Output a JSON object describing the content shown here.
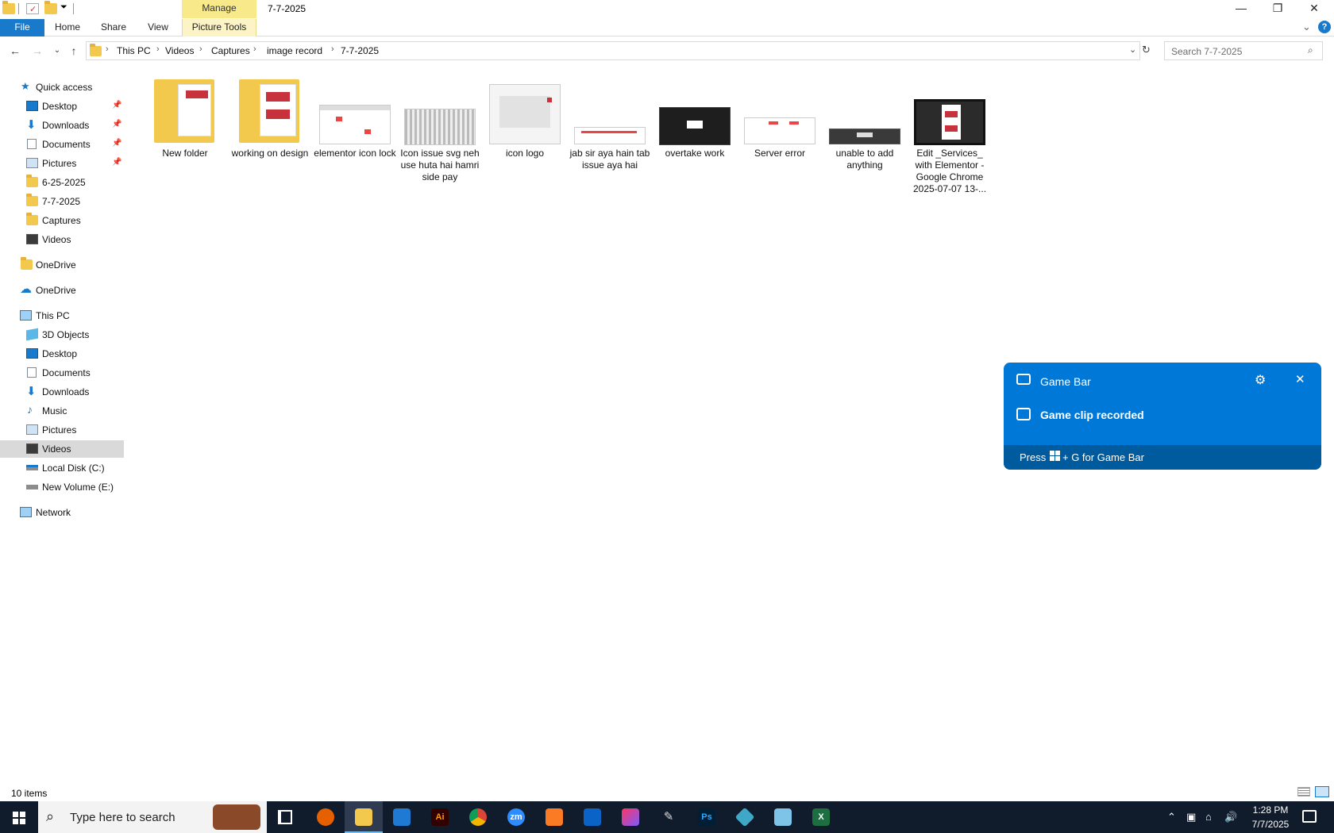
{
  "window": {
    "title": "7-7-2025",
    "manage_label": "Manage",
    "minimize": "—",
    "restore": "❐",
    "close": "✕"
  },
  "ribbon": {
    "tabs": [
      "File",
      "Home",
      "Share",
      "View",
      "Picture Tools"
    ],
    "collapse": "⌄",
    "help": "?"
  },
  "address": {
    "crumbs": [
      "This PC",
      "Videos",
      "Captures",
      "image record",
      "7-7-2025"
    ],
    "search_placeholder": "Search 7-7-2025"
  },
  "sidebar": {
    "quick_access": "Quick access",
    "quick_items": [
      {
        "label": "Desktop",
        "icon": "desktop-icon",
        "pinned": true
      },
      {
        "label": "Downloads",
        "icon": "download-icon",
        "pinned": true
      },
      {
        "label": "Documents",
        "icon": "documents-icon",
        "pinned": true
      },
      {
        "label": "Pictures",
        "icon": "pictures-icon",
        "pinned": true
      },
      {
        "label": "6-25-2025",
        "icon": "folder-icon",
        "pinned": false
      },
      {
        "label": "7-7-2025",
        "icon": "folder-icon",
        "pinned": false
      },
      {
        "label": "Captures",
        "icon": "folder-icon",
        "pinned": false
      },
      {
        "label": "Videos",
        "icon": "videos-icon",
        "pinned": false
      }
    ],
    "onedrive_1": "OneDrive",
    "onedrive_2": "OneDrive",
    "this_pc": "This PC",
    "pc_items": [
      {
        "label": "3D Objects",
        "icon": "3d-objects-icon"
      },
      {
        "label": "Desktop",
        "icon": "desktop-icon"
      },
      {
        "label": "Documents",
        "icon": "documents-icon"
      },
      {
        "label": "Downloads",
        "icon": "download-icon"
      },
      {
        "label": "Music",
        "icon": "music-icon"
      },
      {
        "label": "Pictures",
        "icon": "pictures-icon"
      },
      {
        "label": "Videos",
        "icon": "videos-icon"
      },
      {
        "label": "Local Disk (C:)",
        "icon": "local-disk-icon"
      },
      {
        "label": "New Volume (E:)",
        "icon": "drive-icon"
      }
    ],
    "network": "Network"
  },
  "files": [
    {
      "name": "New folder",
      "type": "folder"
    },
    {
      "name": "working on design",
      "type": "folder"
    },
    {
      "name": "elementor icon lock",
      "type": "image"
    },
    {
      "name": "Icon issue svg neh use huta hai hamri side pay",
      "type": "image"
    },
    {
      "name": "icon logo",
      "type": "image"
    },
    {
      "name": "jab sir aya hain tab issue aya hai",
      "type": "image"
    },
    {
      "name": "overtake work",
      "type": "image"
    },
    {
      "name": "Server error",
      "type": "image"
    },
    {
      "name": "unable to add anything",
      "type": "image"
    },
    {
      "name": "Edit _Services_ with Elementor - Google Chrome 2025-07-07 13-...",
      "type": "video"
    }
  ],
  "status": {
    "item_count": "10 items"
  },
  "gamebar": {
    "title": "Game Bar",
    "message": "Game clip recorded",
    "hint_prefix": "Press",
    "hint_suffix": "+ G for Game Bar"
  },
  "taskbar": {
    "search_placeholder": "Type here to search",
    "time": "1:28 PM",
    "date": "7/7/2025",
    "apps": [
      "firefox-icon",
      "file-explorer-icon",
      "vscode-icon",
      "illustrator-icon",
      "chrome-icon",
      "zoom-icon",
      "xampp-icon",
      "outlook-icon",
      "creative-cloud-icon",
      "pen-tool-icon",
      "photoshop-icon",
      "app-icon",
      "notepad-icon",
      "excel-icon"
    ],
    "app_labels": [
      "",
      "",
      "",
      "Ai",
      "",
      "zm",
      "",
      "",
      "",
      "",
      "Ps",
      "",
      "",
      "X"
    ]
  }
}
